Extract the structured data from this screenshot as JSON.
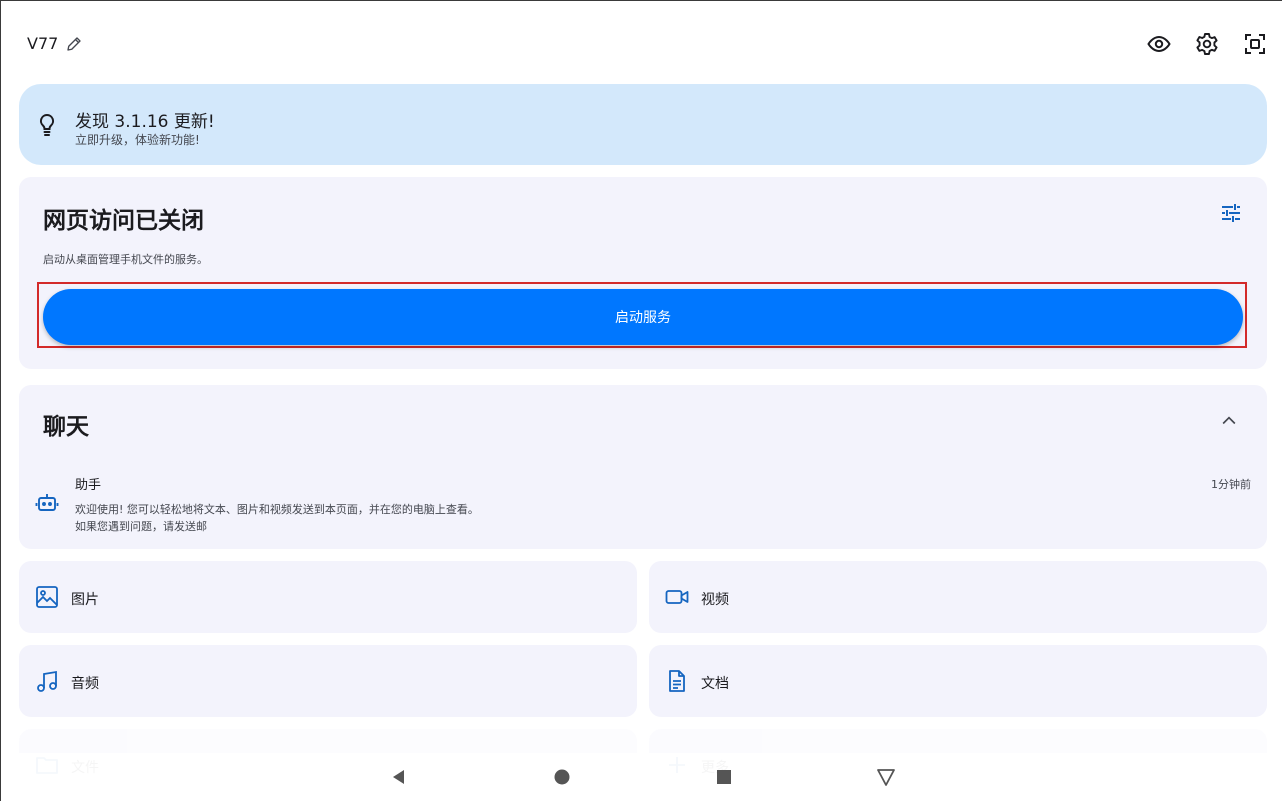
{
  "header": {
    "device_name": "V77",
    "icons": [
      "edit-icon",
      "eye-icon",
      "gear-icon",
      "scan-icon"
    ]
  },
  "update_banner": {
    "title": "发现 3.1.16 更新!",
    "subtitle": "立即升级，体验新功能!"
  },
  "web_access": {
    "title": "网页访问已关闭",
    "description": "启动从桌面管理手机文件的服务。",
    "start_button": "启动服务"
  },
  "chat": {
    "title": "聊天",
    "items": [
      {
        "name": "助手",
        "time": "1分钟前",
        "line1": "欢迎使用! 您可以轻松地将文本、图片和视频发送到本页面，并在您的电脑上查看。",
        "line2": "如果您遇到问题，请发送邮"
      }
    ]
  },
  "tiles": [
    {
      "label": "图片",
      "icon": "image-icon"
    },
    {
      "label": "视频",
      "icon": "video-icon"
    },
    {
      "label": "音频",
      "icon": "music-icon"
    },
    {
      "label": "文档",
      "icon": "document-icon"
    },
    {
      "label": "文件",
      "icon": "folder-icon"
    },
    {
      "label": "更多",
      "icon": "plus-icon"
    }
  ],
  "colors": {
    "accent": "#0077ff",
    "icon_blue": "#1565c0",
    "banner_bg": "#d3e8fb",
    "card_bg": "#f3f3fc",
    "highlight_outline": "#d32a2a"
  }
}
